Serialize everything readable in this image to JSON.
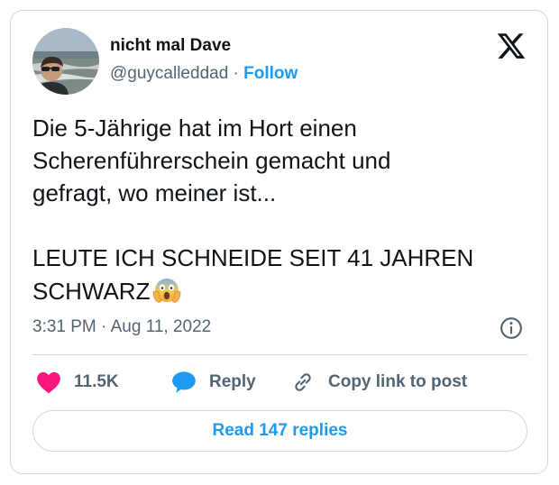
{
  "author": {
    "name": "nicht mal Dave",
    "handle": "@guycalleddad",
    "separator": "·",
    "follow_label": "Follow"
  },
  "tweet": {
    "text": "Die 5-Jährige hat im Hort einen\nScherenführerschein gemacht und\ngefragt, wo meiner ist...\n\nLEUTE ICH SCHNEIDE SEIT 41 JAHREN\nSCHWARZ",
    "emoji": "face-screaming-in-fear",
    "time": "3:31 PM",
    "separator": "·",
    "date": "Aug 11, 2022"
  },
  "actions": {
    "like_count": "11.5K",
    "reply_label": "Reply",
    "copy_label": "Copy link to post"
  },
  "footer": {
    "read_replies_label": "Read 147 replies"
  },
  "colors": {
    "accent": "#1d9bf0",
    "like": "#f91880",
    "text": "#0f1419",
    "secondary": "#536471",
    "border": "#cfd9de"
  },
  "icons": [
    "x-logo-icon",
    "info-icon",
    "heart-icon",
    "reply-bubble-icon",
    "link-icon",
    "screaming-face-emoji"
  ]
}
